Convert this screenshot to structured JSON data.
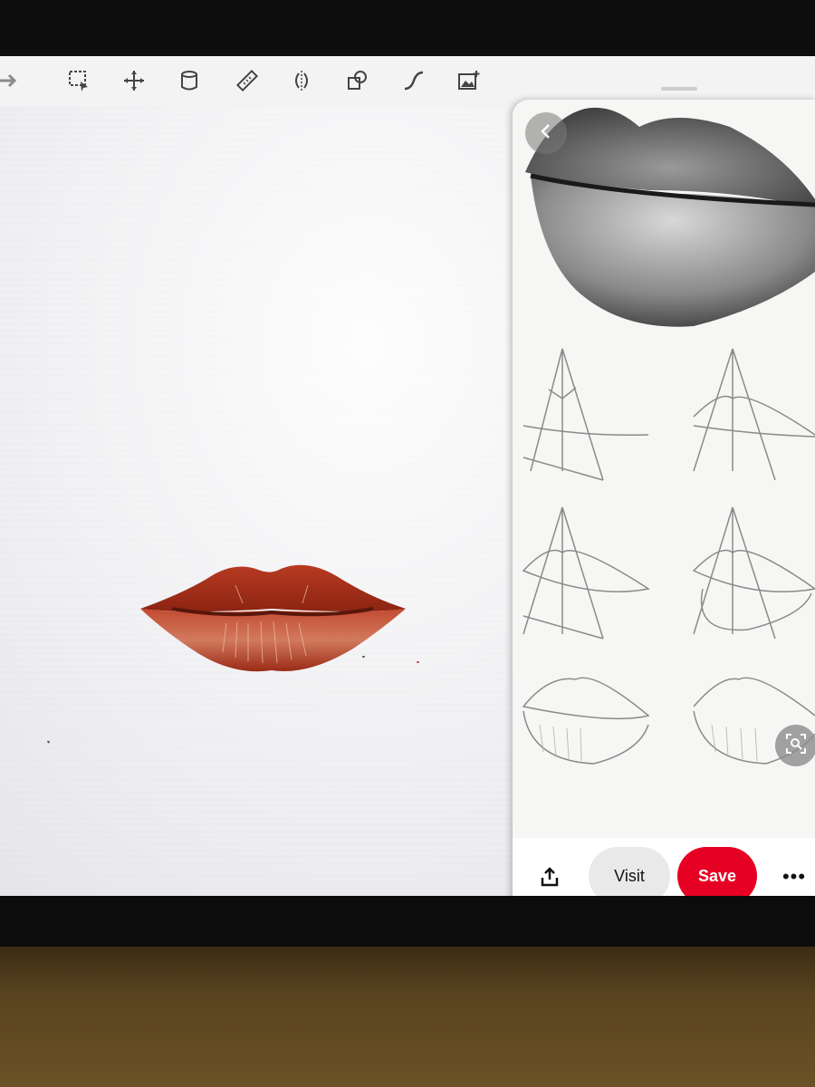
{
  "toolbar": {
    "tools": [
      {
        "name": "arrow-icon"
      },
      {
        "name": "selection-icon"
      },
      {
        "name": "move-icon"
      },
      {
        "name": "paint-bucket-icon"
      },
      {
        "name": "ruler-icon"
      },
      {
        "name": "symmetry-icon"
      },
      {
        "name": "shapes-icon"
      },
      {
        "name": "curve-icon"
      },
      {
        "name": "insert-image-icon"
      }
    ]
  },
  "panel": {
    "visit_label": "Visit",
    "save_label": "Save",
    "more_label": "•••"
  },
  "colors": {
    "save_button": "#e60023",
    "lip_red": "#b5301b",
    "toolbar_bg": "#f3f3f3"
  }
}
